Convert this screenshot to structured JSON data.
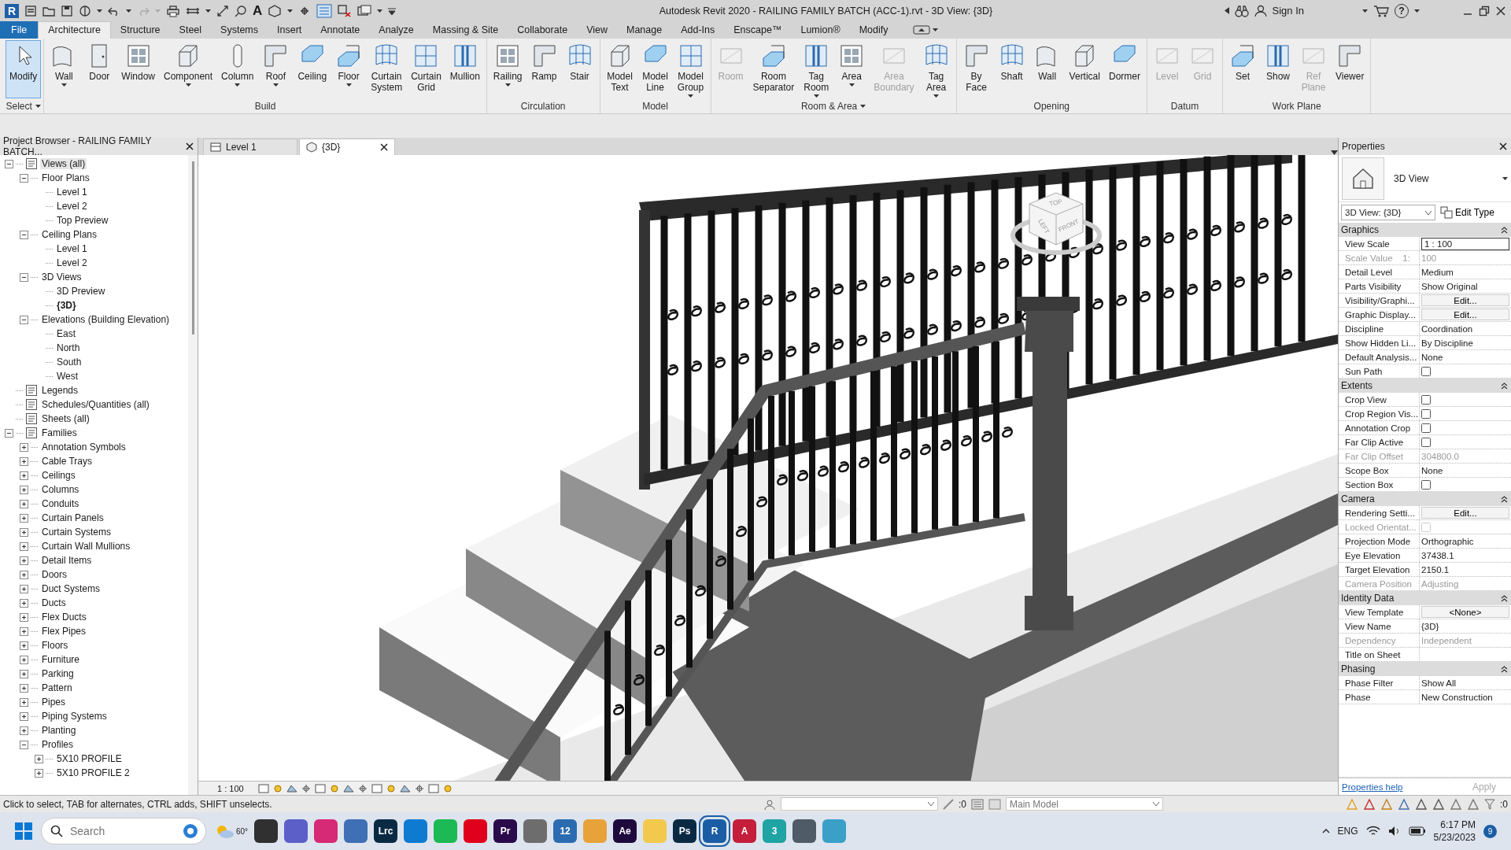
{
  "title_bar": {
    "app_logo": "R",
    "text_tool": "A",
    "title": "Autodesk Revit 2020 - RAILING FAMILY BATCH (ACC-1).rvt - 3D View: {3D}",
    "sign_in": "Sign In",
    "help": "?"
  },
  "menu_tabs": [
    {
      "label": "File",
      "kind": "file",
      "selected": false
    },
    {
      "label": "Architecture",
      "kind": "tab",
      "selected": true
    },
    {
      "label": "Structure",
      "kind": "tab",
      "selected": false
    },
    {
      "label": "Steel",
      "kind": "tab",
      "selected": false
    },
    {
      "label": "Systems",
      "kind": "tab",
      "selected": false
    },
    {
      "label": "Insert",
      "kind": "tab",
      "selected": false
    },
    {
      "label": "Annotate",
      "kind": "tab",
      "selected": false
    },
    {
      "label": "Analyze",
      "kind": "tab",
      "selected": false
    },
    {
      "label": "Massing & Site",
      "kind": "tab",
      "selected": false
    },
    {
      "label": "Collaborate",
      "kind": "tab",
      "selected": false
    },
    {
      "label": "View",
      "kind": "tab",
      "selected": false
    },
    {
      "label": "Manage",
      "kind": "tab",
      "selected": false
    },
    {
      "label": "Add-Ins",
      "kind": "tab",
      "selected": false
    },
    {
      "label": "Enscape™",
      "kind": "tab",
      "selected": false
    },
    {
      "label": "Lumion®",
      "kind": "tab",
      "selected": false
    },
    {
      "label": "Modify",
      "kind": "tab",
      "selected": false
    }
  ],
  "ribbon": [
    {
      "title": "Select",
      "has_menu": true,
      "buttons": [
        {
          "label": "Modify",
          "has_menu": false,
          "disabled": false,
          "selected": true
        }
      ]
    },
    {
      "title": "Build",
      "has_menu": false,
      "buttons": [
        {
          "label": "Wall",
          "has_menu": true,
          "disabled": false,
          "selected": false
        },
        {
          "label": "Door",
          "has_menu": false,
          "disabled": false,
          "selected": false
        },
        {
          "label": "Window",
          "has_menu": false,
          "disabled": false,
          "selected": false
        },
        {
          "label": "Component",
          "has_menu": true,
          "disabled": false,
          "selected": false
        },
        {
          "label": "Column",
          "has_menu": true,
          "disabled": false,
          "selected": false
        },
        {
          "label": "Roof",
          "has_menu": true,
          "disabled": false,
          "selected": false
        },
        {
          "label": "Ceiling",
          "has_menu": false,
          "disabled": false,
          "selected": false
        },
        {
          "label": "Floor",
          "has_menu": true,
          "disabled": false,
          "selected": false
        },
        {
          "label": "Curtain\nSystem",
          "has_menu": false,
          "disabled": false,
          "selected": false
        },
        {
          "label": "Curtain\nGrid",
          "has_menu": false,
          "disabled": false,
          "selected": false
        },
        {
          "label": "Mullion",
          "has_menu": false,
          "disabled": false,
          "selected": false
        }
      ]
    },
    {
      "title": "Circulation",
      "has_menu": false,
      "buttons": [
        {
          "label": "Railing",
          "has_menu": true,
          "disabled": false,
          "selected": false
        },
        {
          "label": "Ramp",
          "has_menu": false,
          "disabled": false,
          "selected": false
        },
        {
          "label": "Stair",
          "has_menu": false,
          "disabled": false,
          "selected": false
        }
      ]
    },
    {
      "title": "Model",
      "has_menu": false,
      "buttons": [
        {
          "label": "Model\nText",
          "has_menu": false,
          "disabled": false,
          "selected": false
        },
        {
          "label": "Model\nLine",
          "has_menu": false,
          "disabled": false,
          "selected": false
        },
        {
          "label": "Model\nGroup",
          "has_menu": true,
          "disabled": false,
          "selected": false
        }
      ]
    },
    {
      "title": "Room & Area",
      "has_menu": true,
      "buttons": [
        {
          "label": "Room",
          "has_menu": false,
          "disabled": true,
          "selected": false
        },
        {
          "label": "Room\nSeparator",
          "has_menu": false,
          "disabled": false,
          "selected": false
        },
        {
          "label": "Tag\nRoom",
          "has_menu": true,
          "disabled": false,
          "selected": false
        },
        {
          "label": "Area",
          "has_menu": true,
          "disabled": false,
          "selected": false
        },
        {
          "label": "Area\nBoundary",
          "has_menu": false,
          "disabled": true,
          "selected": false
        },
        {
          "label": "Tag\nArea",
          "has_menu": true,
          "disabled": false,
          "selected": false
        }
      ]
    },
    {
      "title": "Opening",
      "has_menu": false,
      "buttons": [
        {
          "label": "By\nFace",
          "has_menu": false,
          "disabled": false,
          "selected": false
        },
        {
          "label": "Shaft",
          "has_menu": false,
          "disabled": false,
          "selected": false
        },
        {
          "label": "Wall",
          "has_menu": false,
          "disabled": false,
          "selected": false
        },
        {
          "label": "Vertical",
          "has_menu": false,
          "disabled": false,
          "selected": false
        },
        {
          "label": "Dormer",
          "has_menu": false,
          "disabled": false,
          "selected": false
        }
      ]
    },
    {
      "title": "Datum",
      "has_menu": false,
      "buttons": [
        {
          "label": "Level",
          "has_menu": false,
          "disabled": true,
          "selected": false
        },
        {
          "label": "Grid",
          "has_menu": false,
          "disabled": true,
          "selected": false
        }
      ]
    },
    {
      "title": "Work Plane",
      "has_menu": false,
      "buttons": [
        {
          "label": "Set",
          "has_menu": false,
          "disabled": false,
          "selected": false
        },
        {
          "label": "Show",
          "has_menu": false,
          "disabled": false,
          "selected": false
        },
        {
          "label": "Ref\nPlane",
          "has_menu": false,
          "disabled": true,
          "selected": false
        },
        {
          "label": "Viewer",
          "has_menu": false,
          "disabled": false,
          "selected": false
        }
      ]
    }
  ],
  "project_browser": {
    "title": "Project Browser - RAILING FAMILY BATCH...",
    "items": [
      {
        "label": "Views (all)",
        "expanded": true,
        "children": [
          {
            "label": "Floor Plans",
            "expanded": true,
            "children": [
              {
                "label": "Level 1",
                "current": false
              },
              {
                "label": "Level 2",
                "current": false
              },
              {
                "label": "Top Preview",
                "current": false
              }
            ]
          },
          {
            "label": "Ceiling Plans",
            "expanded": true,
            "children": [
              {
                "label": "Level 1",
                "current": false
              },
              {
                "label": "Level 2",
                "current": false
              }
            ]
          },
          {
            "label": "3D Views",
            "expanded": true,
            "children": [
              {
                "label": "3D Preview",
                "current": false
              },
              {
                "label": "{3D}",
                "current": true
              }
            ]
          },
          {
            "label": "Elevations (Building Elevation)",
            "expanded": true,
            "children": [
              {
                "label": "East",
                "current": false
              },
              {
                "label": "North",
                "current": false
              },
              {
                "label": "South",
                "current": false
              },
              {
                "label": "West",
                "current": false
              }
            ]
          }
        ]
      },
      {
        "label": "Legends"
      },
      {
        "label": "Schedules/Quantities (all)"
      },
      {
        "label": "Sheets (all)"
      },
      {
        "label": "Families",
        "expanded": true,
        "children": [
          {
            "label": "Annotation Symbols",
            "expanded": false
          },
          {
            "label": "Cable Trays",
            "expanded": false
          },
          {
            "label": "Ceilings",
            "expanded": false
          },
          {
            "label": "Columns",
            "expanded": false
          },
          {
            "label": "Conduits",
            "expanded": false
          },
          {
            "label": "Curtain Panels",
            "expanded": false
          },
          {
            "label": "Curtain Systems",
            "expanded": false
          },
          {
            "label": "Curtain Wall Mullions",
            "expanded": false
          },
          {
            "label": "Detail Items",
            "expanded": false
          },
          {
            "label": "Doors",
            "expanded": false
          },
          {
            "label": "Duct Systems",
            "expanded": false
          },
          {
            "label": "Ducts",
            "expanded": false
          },
          {
            "label": "Flex Ducts",
            "expanded": false
          },
          {
            "label": "Flex Pipes",
            "expanded": false
          },
          {
            "label": "Floors",
            "expanded": false
          },
          {
            "label": "Furniture",
            "expanded": false
          },
          {
            "label": "Parking",
            "expanded": false
          },
          {
            "label": "Pattern",
            "expanded": false
          },
          {
            "label": "Pipes",
            "expanded": false
          },
          {
            "label": "Piping Systems",
            "expanded": false
          },
          {
            "label": "Planting",
            "expanded": false
          },
          {
            "label": "Profiles",
            "expanded": true,
            "children": [
              {
                "label": "5X10 PROFILE",
                "expanded": false
              },
              {
                "label": "5X10 PROFILE 2",
                "expanded": false
              }
            ]
          }
        ]
      }
    ]
  },
  "view_tabs": [
    {
      "label": "Level 1",
      "selected": false
    },
    {
      "label": "{3D}",
      "selected": true
    }
  ],
  "view_cube": {
    "top": "TOP",
    "left": "LEFT",
    "front": "FRONT"
  },
  "view_control_bar": {
    "scale": "1 : 100"
  },
  "properties": {
    "title": "Properties",
    "type_name": "3D View",
    "instance": "3D View: {3D}",
    "edit_type": "Edit Type",
    "sections": [
      {
        "title": "Graphics",
        "expanded": true,
        "rows": [
          {
            "name": "View Scale",
            "kind": "field",
            "value": "1 : 100",
            "disabled": false
          },
          {
            "name": "Scale Value    1:",
            "kind": "text",
            "value": "100",
            "disabled": true
          },
          {
            "name": "Detail Level",
            "kind": "text",
            "value": "Medium",
            "disabled": false
          },
          {
            "name": "Parts Visibility",
            "kind": "text",
            "value": "Show Original",
            "disabled": false
          },
          {
            "name": "Visibility/Graphi...",
            "kind": "button",
            "value": "Edit...",
            "disabled": false
          },
          {
            "name": "Graphic Display...",
            "kind": "button",
            "value": "Edit...",
            "disabled": false
          },
          {
            "name": "Discipline",
            "kind": "text",
            "value": "Coordination",
            "disabled": false
          },
          {
            "name": "Show Hidden Li...",
            "kind": "text",
            "value": "By Discipline",
            "disabled": false
          },
          {
            "name": "Default Analysis...",
            "kind": "text",
            "value": "None",
            "disabled": false
          },
          {
            "name": "Sun Path",
            "kind": "checkbox",
            "checked": false,
            "disabled": false
          }
        ]
      },
      {
        "title": "Extents",
        "expanded": true,
        "rows": [
          {
            "name": "Crop View",
            "kind": "checkbox",
            "checked": false,
            "disabled": false
          },
          {
            "name": "Crop Region Vis...",
            "kind": "checkbox",
            "checked": false,
            "disabled": false
          },
          {
            "name": "Annotation Crop",
            "kind": "checkbox",
            "checked": false,
            "disabled": false
          },
          {
            "name": "Far Clip Active",
            "kind": "checkbox",
            "checked": false,
            "disabled": false
          },
          {
            "name": "Far Clip Offset",
            "kind": "text",
            "value": "304800.0",
            "disabled": true
          },
          {
            "name": "Scope Box",
            "kind": "text",
            "value": "None",
            "disabled": false
          },
          {
            "name": "Section Box",
            "kind": "checkbox",
            "checked": false,
            "disabled": false
          }
        ]
      },
      {
        "title": "Camera",
        "expanded": true,
        "rows": [
          {
            "name": "Rendering Setti...",
            "kind": "button",
            "value": "Edit...",
            "disabled": false
          },
          {
            "name": "Locked Orientat...",
            "kind": "checkbox",
            "checked": false,
            "disabled": true
          },
          {
            "name": "Projection Mode",
            "kind": "text",
            "value": "Orthographic",
            "disabled": false
          },
          {
            "name": "Eye Elevation",
            "kind": "text",
            "value": "37438.1",
            "disabled": false
          },
          {
            "name": "Target Elevation",
            "kind": "text",
            "value": "2150.1",
            "disabled": false
          },
          {
            "name": "Camera Position",
            "kind": "text",
            "value": "Adjusting",
            "disabled": true
          }
        ]
      },
      {
        "title": "Identity Data",
        "expanded": true,
        "rows": [
          {
            "name": "View Template",
            "kind": "button",
            "value": "<None>",
            "disabled": false
          },
          {
            "name": "View Name",
            "kind": "text",
            "value": "{3D}",
            "disabled": false
          },
          {
            "name": "Dependency",
            "kind": "text",
            "value": "Independent",
            "disabled": true
          },
          {
            "name": "Title on Sheet",
            "kind": "text",
            "disabled": false
          }
        ]
      },
      {
        "title": "Phasing",
        "expanded": true,
        "rows": [
          {
            "name": "Phase Filter",
            "kind": "text",
            "value": "Show All",
            "disabled": false
          },
          {
            "name": "Phase",
            "kind": "text",
            "value": "New Construction",
            "disabled": false
          }
        ]
      }
    ],
    "help_link": "Properties help",
    "apply": "Apply",
    "apply_disabled": true
  },
  "status_bar": {
    "message": "Click to select, TAB for alternates, CTRL adds, SHIFT unselects.",
    "selection_count": ":0",
    "model": "Main Model",
    "filter_count": ":0"
  },
  "taskbar": {
    "search_placeholder": "Search",
    "weather": "60°",
    "apps": [
      {
        "color": "#303030",
        "selected": false
      },
      {
        "color": "#5b5fc7",
        "selected": false
      },
      {
        "color": "#d62976",
        "selected": false
      },
      {
        "color": "#3f6fb5",
        "selected": false
      },
      {
        "label": "Lrc",
        "color": "#0a2a44",
        "selected": false
      },
      {
        "color": "#0f7bd0",
        "selected": false
      },
      {
        "color": "#1db954",
        "selected": false
      },
      {
        "color": "#e0001b",
        "selected": false
      },
      {
        "label": "Pr",
        "color": "#2a0a4a",
        "selected": false
      },
      {
        "color": "#6d6d6d",
        "selected": false
      },
      {
        "label": "12",
        "color": "#2b6cb0",
        "selected": false
      },
      {
        "color": "#e8a23a",
        "selected": false
      },
      {
        "label": "Ae",
        "color": "#1f0a3d",
        "selected": false
      },
      {
        "color": "#f2c94c",
        "selected": false
      },
      {
        "label": "Ps",
        "color": "#0a2a44",
        "selected": false
      },
      {
        "label": "R",
        "color": "#1b5da5",
        "selected": true
      },
      {
        "label": "A",
        "color": "#c41e3a",
        "selected": false
      },
      {
        "label": "3",
        "color": "#1fa3a3",
        "selected": false
      },
      {
        "color": "#4f5b66",
        "selected": false
      },
      {
        "color": "#3aa0c8",
        "selected": false
      }
    ],
    "language": "ENG",
    "time": "6:17 PM",
    "date": "5/23/2023",
    "notifications": "9"
  }
}
